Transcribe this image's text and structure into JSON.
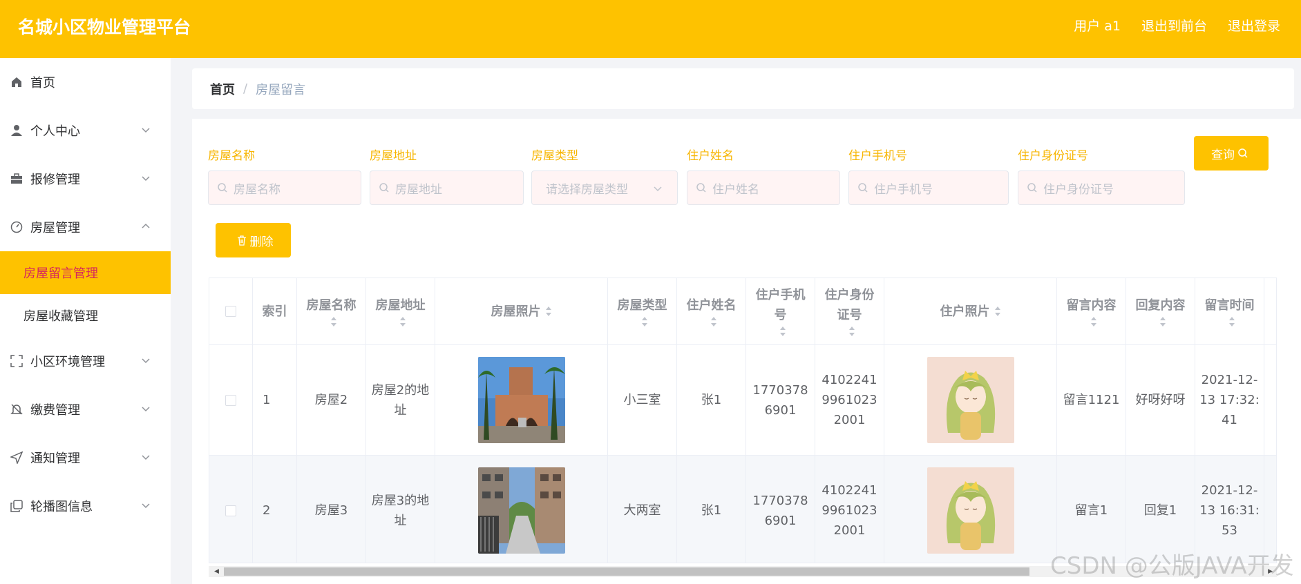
{
  "header": {
    "title": "名城小区物业管理平台",
    "user": "用户 a1",
    "front_label": "退出到前台",
    "logout_label": "退出登录"
  },
  "sidebar": {
    "home": "首页",
    "personal": "个人中心",
    "repair": "报修管理",
    "house": "房屋管理",
    "house_sub": [
      "房屋留言管理",
      "房屋收藏管理"
    ],
    "environment": "小区环境管理",
    "payment": "缴费管理",
    "notice": "通知管理",
    "carousel": "轮播图信息"
  },
  "breadcrumb": {
    "home": "首页",
    "separator": "/",
    "current": "房屋留言"
  },
  "filters": {
    "house_name": {
      "label": "房屋名称",
      "placeholder": "房屋名称"
    },
    "house_address": {
      "label": "房屋地址",
      "placeholder": "房屋地址"
    },
    "house_type": {
      "label": "房屋类型",
      "placeholder": "请选择房屋类型"
    },
    "resident_name": {
      "label": "住户姓名",
      "placeholder": "住户姓名"
    },
    "resident_phone": {
      "label": "住户手机号",
      "placeholder": "住户手机号"
    },
    "resident_id": {
      "label": "住户身份证号",
      "placeholder": "住户身份证号"
    },
    "query_label": "查询",
    "delete_label": "删除"
  },
  "table": {
    "headers": [
      "索引",
      "房屋名称",
      "房屋地址",
      "房屋照片",
      "房屋类型",
      "住户姓名",
      "住户手机号",
      "住户身份证号",
      "住户照片",
      "留言内容",
      "回复内容",
      "留言时间"
    ],
    "rows": [
      {
        "index": "1",
        "name": "房屋2",
        "address": "房屋2的地址",
        "type": "小三室",
        "resident": "张1",
        "phone": "17703786901",
        "id_no": "410224199610232001",
        "message": "留言1121",
        "reply": "好呀好呀",
        "time": "2021-12-13 17:32:41"
      },
      {
        "index": "2",
        "name": "房屋3",
        "address": "房屋3的地址",
        "type": "大两室",
        "resident": "张1",
        "phone": "17703786901",
        "id_no": "410224199610232001",
        "message": "留言1",
        "reply": "回复1",
        "time": "2021-12-13 16:31:53"
      }
    ]
  },
  "watermark": "CSDN @公版JAVA开发",
  "colors": {
    "accent": "#fec200",
    "active_text": "#d6265c",
    "label": "#f7b500"
  }
}
